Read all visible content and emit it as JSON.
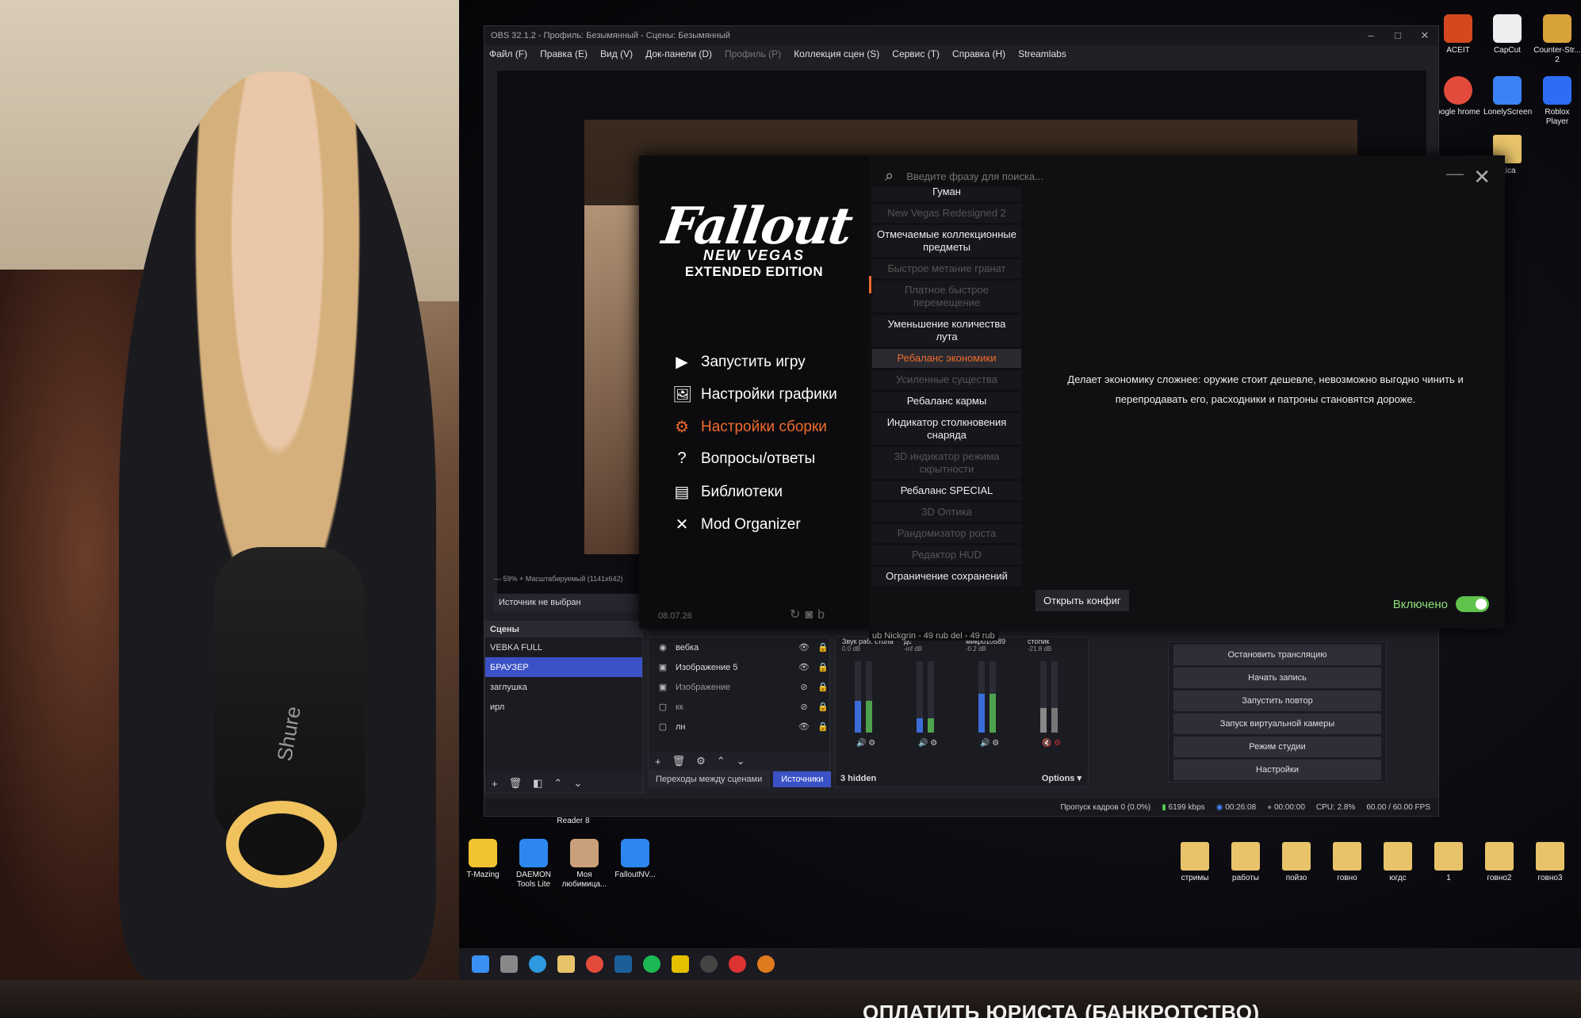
{
  "webcam": {
    "mic_label": "Shure"
  },
  "obs": {
    "title": "OBS 32.1.2 - Профиль: Безымянный - Сцены: Безымянный",
    "menu": [
      {
        "label": "Файл (F)",
        "enabled": true
      },
      {
        "label": "Правка (E)",
        "enabled": true
      },
      {
        "label": "Вид (V)",
        "enabled": true
      },
      {
        "label": "Док-панели (D)",
        "enabled": true
      },
      {
        "label": "Профиль (P)",
        "enabled": false
      },
      {
        "label": "Коллекция сцен (S)",
        "enabled": true
      },
      {
        "label": "Сервис (T)",
        "enabled": true
      },
      {
        "label": "Справка (H)",
        "enabled": true
      },
      {
        "label": "Streamlabs",
        "enabled": true
      }
    ],
    "preview_status": "—   59%   +   Масштабируемый (1141x642)",
    "no_source": "Источник не выбран",
    "scenes_header": "Сцены",
    "scenes": [
      {
        "label": "VEBKA FULL",
        "selected": false
      },
      {
        "label": "БРАУЗЕР",
        "selected": true
      },
      {
        "label": "заглушка",
        "selected": false
      },
      {
        "label": "ирл",
        "selected": false
      }
    ],
    "sources": [
      {
        "label": "вебка",
        "visible": true
      },
      {
        "label": "Изображение 5",
        "visible": true
      },
      {
        "label": "Изображение",
        "visible": false
      },
      {
        "label": "кк",
        "visible": false
      },
      {
        "label": "лн",
        "visible": true
      }
    ],
    "tabs": [
      "Переходы между сценами",
      "Источники"
    ],
    "mixer": {
      "channels": [
        {
          "name": "Звук раб. стола",
          "db": "0.0 dB",
          "level": 0.45
        },
        {
          "name": "дс",
          "db": "-inf dB",
          "level": 0.2
        },
        {
          "name": "микро10589",
          "db": "-0.2 dB",
          "level": 0.55
        },
        {
          "name": "стопик",
          "db": "-21.8 dB",
          "level": 0.35
        }
      ],
      "hidden": "3 hidden",
      "options": "Options"
    },
    "controls": [
      "Остановить трансляцию",
      "Начать запись",
      "Запустить повтор",
      "Запуск виртуальной камеры",
      "Режим студии",
      "Настройки"
    ],
    "status": {
      "dropped": "Пропуск кадров 0 (0.0%)",
      "bitrate": "6199 kbps",
      "live_time": "00:26:08",
      "rec_time": "00:00:00",
      "cpu": "CPU: 2.8%",
      "fps": "60.00 / 60.00 FPS"
    },
    "donation_ticker": "ub  Nickgrin - 49 rub   del - 49 rub"
  },
  "launcher": {
    "logo": {
      "line1": "Fallout",
      "line2": "NEW VEGAS",
      "line3": "EXTENDED EDITION"
    },
    "menu": [
      {
        "label": "Запустить игру",
        "icon": "play-icon",
        "active": false
      },
      {
        "label": "Настройки графики",
        "icon": "display-icon",
        "active": false
      },
      {
        "label": "Настройки сборки",
        "icon": "gear-icon",
        "active": true
      },
      {
        "label": "Вопросы/ответы",
        "icon": "question-icon",
        "active": false
      },
      {
        "label": "Библиотеки",
        "icon": "library-icon",
        "active": false
      },
      {
        "label": "Mod Organizer",
        "icon": "tools-icon",
        "active": false
      }
    ],
    "date": "08.07.26",
    "search_placeholder": "Введите фразу для поиска...",
    "options": [
      {
        "label": "Гуман",
        "state": "on"
      },
      {
        "label": "New Vegas Redesigned 2",
        "state": "off"
      },
      {
        "label": "Отмечаемые коллекционные предметы",
        "state": "on"
      },
      {
        "label": "Быстрое метание гранат",
        "state": "off"
      },
      {
        "label": "Платное быстрое перемещение",
        "state": "off"
      },
      {
        "label": "Уменьшение количества лута",
        "state": "on"
      },
      {
        "label": "Ребаланс экономики",
        "state": "selected"
      },
      {
        "label": "Усиленные существа",
        "state": "off"
      },
      {
        "label": "Ребаланс кармы",
        "state": "on"
      },
      {
        "label": "Индикатор столкновения снаряда",
        "state": "on"
      },
      {
        "label": "3D индикатор режима скрытности",
        "state": "off"
      },
      {
        "label": "Ребаланс SPECIAL",
        "state": "on"
      },
      {
        "label": "3D Оптика",
        "state": "off"
      },
      {
        "label": "Рандомизатор роста",
        "state": "off"
      },
      {
        "label": "Редактор HUD",
        "state": "off"
      },
      {
        "label": "Ограничение сохранений",
        "state": "on"
      }
    ],
    "description": "Делает экономику сложнее: оружие стоит дешевле, невозможно выгодно чинить и перепродавать его, расходники и патроны становятся дороже.",
    "open_config": "Открыть конфиг",
    "enabled_label": "Включено"
  },
  "desktop": {
    "right_top": [
      "ACEIT",
      "CapCut",
      "Counter-Str... 2",
      "oogle hrome",
      "LonelyScreen",
      "Roblox Player",
      "utica"
    ],
    "left_icons": [
      "Reader 8"
    ],
    "bottom_icons": [
      "T-Mazing",
      "DAEMON Tools Lite",
      "Моя любимица...",
      "FalloutNV..."
    ],
    "folders": [
      "стримы",
      "работы",
      "пойзо",
      "говно",
      "югдс",
      "1",
      "говно2",
      "говно3"
    ]
  },
  "overlay_text": "ОПЛАТИТЬ ЮРИСТА (БАНКРОТСТВО)"
}
